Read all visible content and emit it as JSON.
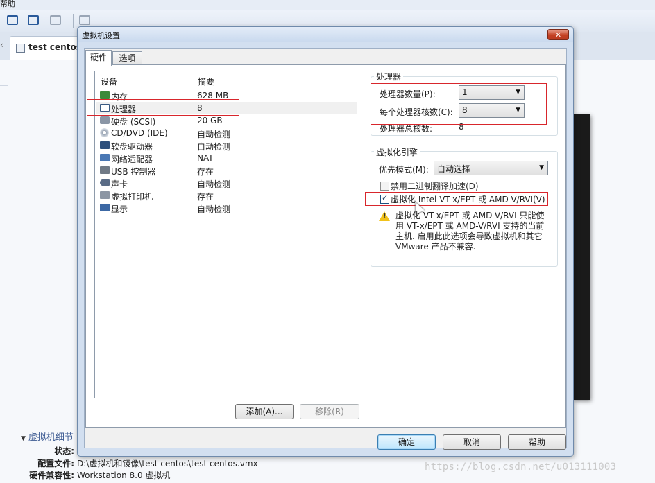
{
  "menu": {
    "help": "帮助"
  },
  "background": {
    "tab_label": "test centos",
    "details_title": "虚拟机细节",
    "details": [
      {
        "key": "状态:",
        "value": ""
      },
      {
        "key": "配置文件:",
        "value": "D:\\虚拟机和镜像\\test centos\\test centos.vmx"
      },
      {
        "key": "硬件兼容性:",
        "value": "Workstation 8.0 虚拟机"
      }
    ]
  },
  "watermark": "https://blog.csdn.net/u013111003",
  "dialog": {
    "title": "虚拟机设置",
    "close_glyph": "✕",
    "tabs": {
      "hardware": "硬件",
      "options": "选项"
    },
    "device_list": {
      "col_device": "设备",
      "col_summary": "摘要",
      "rows": [
        {
          "name": "内存",
          "summary": "628 MB",
          "icon": "memory-icon"
        },
        {
          "name": "处理器",
          "summary": "8",
          "icon": "processor-icon"
        },
        {
          "name": "硬盘 (SCSI)",
          "summary": "20 GB",
          "icon": "hard-disk-icon"
        },
        {
          "name": "CD/DVD (IDE)",
          "summary": "自动检测",
          "icon": "cd-dvd-icon"
        },
        {
          "name": "软盘驱动器",
          "summary": "自动检测",
          "icon": "floppy-icon"
        },
        {
          "name": "网络适配器",
          "summary": "NAT",
          "icon": "network-adapter-icon"
        },
        {
          "name": "USB 控制器",
          "summary": "存在",
          "icon": "usb-icon"
        },
        {
          "name": "声卡",
          "summary": "自动检测",
          "icon": "sound-card-icon"
        },
        {
          "name": "虚拟打印机",
          "summary": "存在",
          "icon": "printer-icon"
        },
        {
          "name": "显示",
          "summary": "自动检测",
          "icon": "display-icon"
        }
      ],
      "selected_index": 1
    },
    "add_button": "添加(A)...",
    "remove_button": "移除(R)",
    "processor": {
      "group_title": "处理器",
      "count_label": "处理器数量(P):",
      "count_value": "1",
      "cores_label": "每个处理器核数(C):",
      "cores_value": "8",
      "total_label": "处理器总核数:",
      "total_value": "8"
    },
    "virtualization": {
      "group_title": "虚拟化引擎",
      "mode_label": "优先模式(M):",
      "mode_value": "自动选择",
      "disable_bt_label": "禁用二进制翻译加速(D)",
      "disable_bt_checked": false,
      "vtx_label": "虚拟化 Intel VT-x/EPT 或 AMD-V/RVI(V)",
      "vtx_checked": true,
      "warning_lines": [
        "虚拟化 VT-x/EPT 或 AMD-V/RVI 只能使",
        "用 VT-x/EPT 或 AMD-V/RVI 支持的当前",
        "主机. 启用此此选项会导致虚拟机和其它",
        "VMware 产品不兼容."
      ]
    },
    "ok_button": "确定",
    "cancel_button": "取消",
    "help_button": "帮助"
  },
  "colors": {
    "highlight_box": "#d8262c",
    "title_bar": "#c9d9ee",
    "close_button": "#c44124"
  }
}
